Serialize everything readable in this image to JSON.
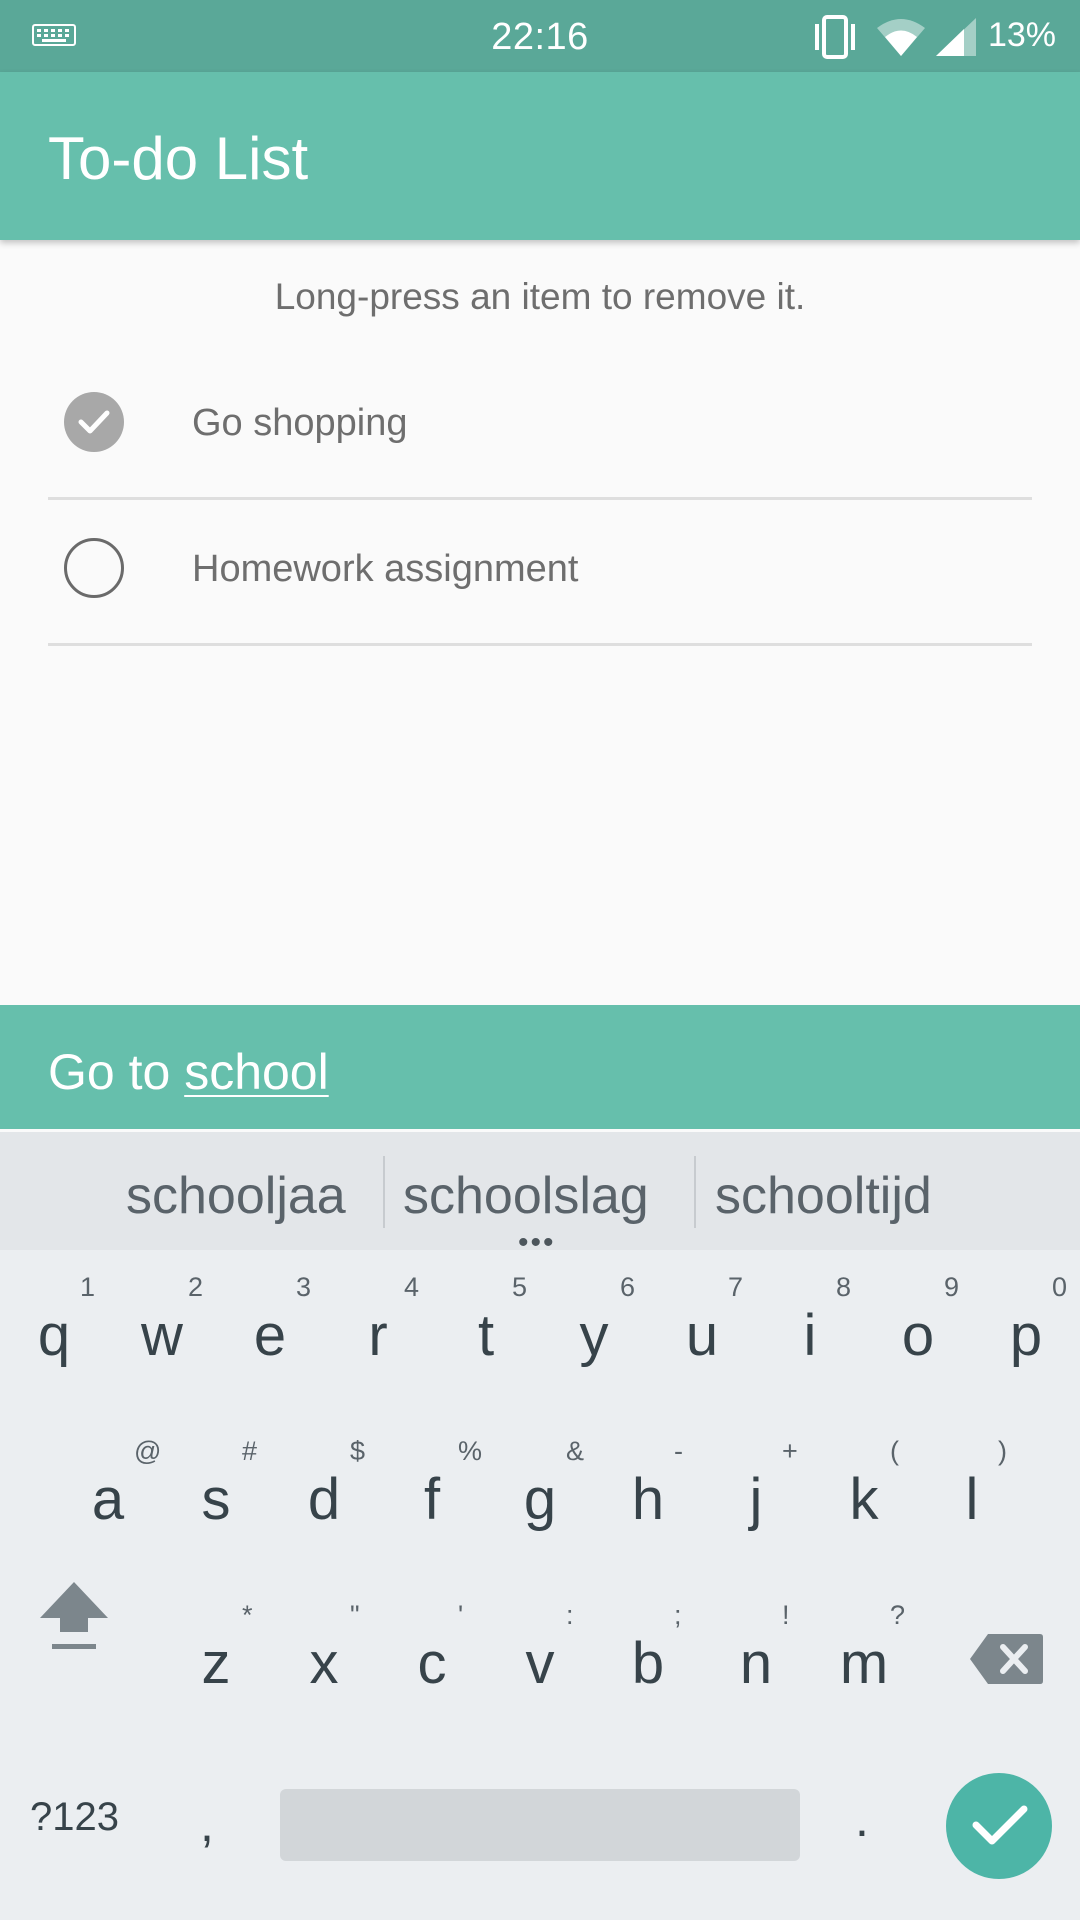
{
  "status_bar": {
    "time": "22:16",
    "battery": "13%"
  },
  "app_bar": {
    "title": "To-do List"
  },
  "hint": "Long-press an item to remove it.",
  "todos": [
    {
      "label": "Go shopping",
      "checked": true
    },
    {
      "label": "Homework assignment",
      "checked": false
    }
  ],
  "input": {
    "prefix": "Go to ",
    "composing": "school"
  },
  "suggestions": [
    "schooljaa",
    "schoolslag",
    "schooltijd"
  ],
  "keyboard": {
    "row1": [
      {
        "key": "q",
        "hint": "1"
      },
      {
        "key": "w",
        "hint": "2"
      },
      {
        "key": "e",
        "hint": "3"
      },
      {
        "key": "r",
        "hint": "4"
      },
      {
        "key": "t",
        "hint": "5"
      },
      {
        "key": "y",
        "hint": "6"
      },
      {
        "key": "u",
        "hint": "7"
      },
      {
        "key": "i",
        "hint": "8"
      },
      {
        "key": "o",
        "hint": "9"
      },
      {
        "key": "p",
        "hint": "0"
      }
    ],
    "row2": [
      {
        "key": "a",
        "hint": "@"
      },
      {
        "key": "s",
        "hint": "#"
      },
      {
        "key": "d",
        "hint": "$"
      },
      {
        "key": "f",
        "hint": "%"
      },
      {
        "key": "g",
        "hint": "&"
      },
      {
        "key": "h",
        "hint": "-"
      },
      {
        "key": "j",
        "hint": "+"
      },
      {
        "key": "k",
        "hint": "("
      },
      {
        "key": "l",
        "hint": ")"
      }
    ],
    "row3": [
      {
        "key": "z",
        "hint": "*"
      },
      {
        "key": "x",
        "hint": "\""
      },
      {
        "key": "c",
        "hint": "'"
      },
      {
        "key": "v",
        "hint": ":"
      },
      {
        "key": "b",
        "hint": ";"
      },
      {
        "key": "n",
        "hint": "!"
      },
      {
        "key": "m",
        "hint": "?"
      }
    ],
    "symbols_label": "?123",
    "comma": ",",
    "period": "."
  },
  "icons": {
    "status": [
      "keyboard-icon",
      "vibrate-icon",
      "wifi-icon",
      "signal-icon"
    ],
    "shift": "shift-icon",
    "delete": "backspace-icon",
    "enter": "checkmark-icon"
  },
  "colors": {
    "status_bar": "#5aa898",
    "app_bar": "#66bfac",
    "enter_button": "#4db5a7",
    "keyboard_bg": "#ebeef1"
  }
}
